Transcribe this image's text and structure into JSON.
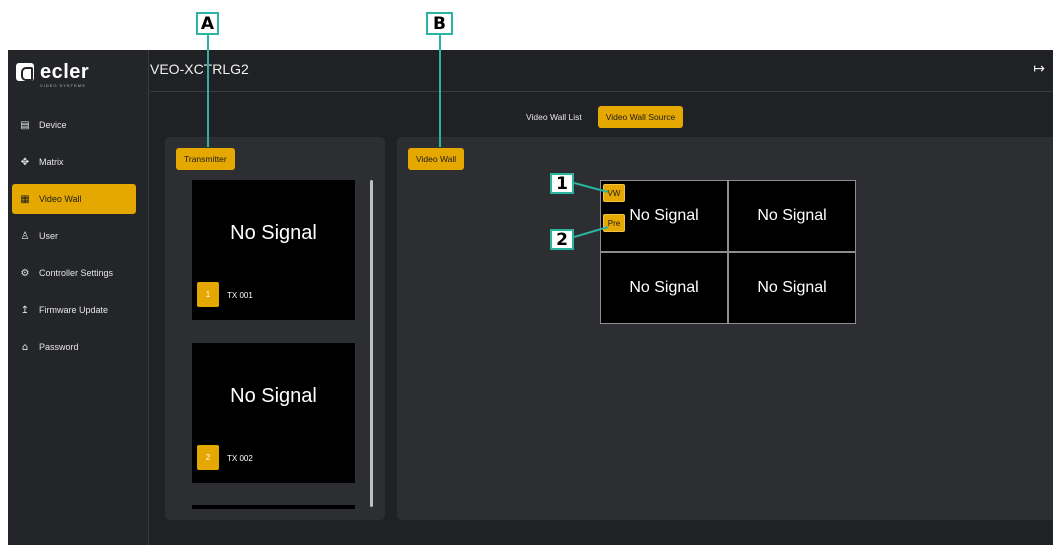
{
  "annotations": {
    "a": "A",
    "b": "B",
    "one": "1",
    "two": "2"
  },
  "app": {
    "brand": "ecler",
    "brand_sub": "VIDEO SYSTEMS",
    "device_title": "VEO-XCTRLG2",
    "logout_icon": "logout-icon"
  },
  "sidebar": {
    "items": [
      {
        "label": "Device",
        "icon": "device-icon",
        "glyph": "▤"
      },
      {
        "label": "Matrix",
        "icon": "matrix-icon",
        "glyph": "✥"
      },
      {
        "label": "Video Wall",
        "icon": "video-wall-icon",
        "glyph": "▦"
      },
      {
        "label": "User",
        "icon": "user-icon",
        "glyph": "♙"
      },
      {
        "label": "Controller Settings",
        "icon": "gear-icon",
        "glyph": "⚙"
      },
      {
        "label": "Firmware Update",
        "icon": "upload-icon",
        "glyph": "↥"
      },
      {
        "label": "Password",
        "icon": "lock-icon",
        "glyph": "⌂"
      }
    ],
    "active_label": "Video Wall"
  },
  "tabs": {
    "list": "Video Wall List",
    "source": "Video Wall Source"
  },
  "transmitter": {
    "chip": "Transmitter",
    "cards": [
      {
        "signal": "No Signal",
        "number": "1",
        "name": "TX 001"
      },
      {
        "signal": "No Signal",
        "number": "2",
        "name": "TX 002"
      }
    ]
  },
  "video_wall": {
    "chip": "Video Wall",
    "cells": [
      "No Signal",
      "No Signal",
      "No Signal",
      "No Signal"
    ],
    "vw_label": "VW",
    "pre_label": "Pre"
  },
  "colors": {
    "accent": "#e5a800",
    "background": "#202124",
    "panel": "#2d2e31",
    "callout": "#2bb5a0"
  }
}
